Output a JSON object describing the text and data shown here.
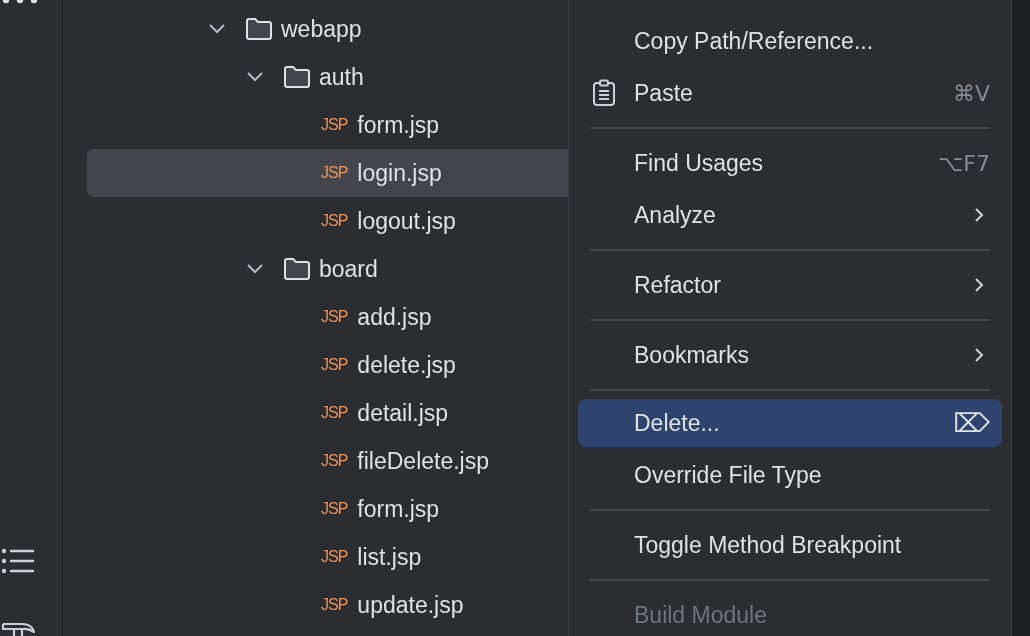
{
  "tree": [
    {
      "kind": "folder",
      "name": "webapp",
      "expanded": true,
      "children": [
        {
          "kind": "folder",
          "name": "auth",
          "expanded": true,
          "children": [
            {
              "kind": "file",
              "badge": "JSP",
              "name": "form.jsp",
              "selected": false
            },
            {
              "kind": "file",
              "badge": "JSP",
              "name": "login.jsp",
              "selected": true
            },
            {
              "kind": "file",
              "badge": "JSP",
              "name": "logout.jsp",
              "selected": false
            }
          ]
        },
        {
          "kind": "folder",
          "name": "board",
          "expanded": true,
          "children": [
            {
              "kind": "file",
              "badge": "JSP",
              "name": "add.jsp",
              "selected": false
            },
            {
              "kind": "file",
              "badge": "JSP",
              "name": "delete.jsp",
              "selected": false
            },
            {
              "kind": "file",
              "badge": "JSP",
              "name": "detail.jsp",
              "selected": false
            },
            {
              "kind": "file",
              "badge": "JSP",
              "name": "fileDelete.jsp",
              "selected": false
            },
            {
              "kind": "file",
              "badge": "JSP",
              "name": "form.jsp",
              "selected": false
            },
            {
              "kind": "file",
              "badge": "JSP",
              "name": "list.jsp",
              "selected": false
            },
            {
              "kind": "file",
              "badge": "JSP",
              "name": "update.jsp",
              "selected": false
            }
          ]
        }
      ]
    }
  ],
  "context_menu": {
    "items": [
      {
        "kind": "item",
        "label": "Copy Path/Reference...",
        "has_icon": false,
        "submenu": false,
        "selected": false,
        "disabled": false
      },
      {
        "kind": "item",
        "label": "Paste",
        "shortcut": "⌘V",
        "has_icon": true,
        "submenu": false,
        "selected": false,
        "disabled": false
      },
      {
        "kind": "separator"
      },
      {
        "kind": "item",
        "label": "Find Usages",
        "shortcut": "⌥F7",
        "has_icon": false,
        "submenu": false,
        "selected": false,
        "disabled": false
      },
      {
        "kind": "item",
        "label": "Analyze",
        "has_icon": false,
        "submenu": true,
        "selected": false,
        "disabled": false
      },
      {
        "kind": "separator"
      },
      {
        "kind": "item",
        "label": "Refactor",
        "has_icon": false,
        "submenu": true,
        "selected": false,
        "disabled": false
      },
      {
        "kind": "separator"
      },
      {
        "kind": "item",
        "label": "Bookmarks",
        "has_icon": false,
        "submenu": true,
        "selected": false,
        "disabled": false
      },
      {
        "kind": "separator"
      },
      {
        "kind": "item",
        "label": "Delete...",
        "shortcut": "⌦",
        "has_icon": false,
        "submenu": false,
        "selected": true,
        "disabled": false
      },
      {
        "kind": "item",
        "label": "Override File Type",
        "has_icon": false,
        "submenu": false,
        "selected": false,
        "disabled": false
      },
      {
        "kind": "separator"
      },
      {
        "kind": "item",
        "label": "Toggle Method Breakpoint",
        "has_icon": false,
        "submenu": false,
        "selected": false,
        "disabled": false
      },
      {
        "kind": "separator"
      },
      {
        "kind": "item",
        "label": "Build Module",
        "has_icon": false,
        "submenu": false,
        "selected": false,
        "disabled": true
      }
    ]
  }
}
